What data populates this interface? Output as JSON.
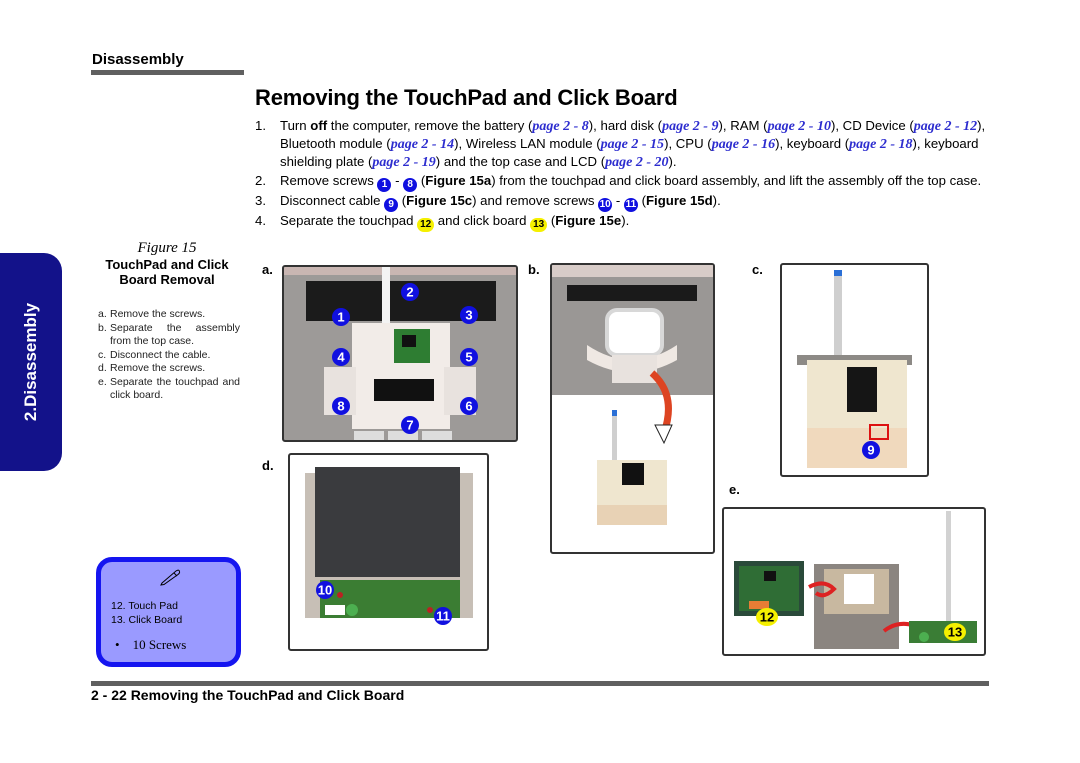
{
  "header": {
    "section_label": "Disassembly",
    "title": "Removing the TouchPad and Click Board"
  },
  "side_tab": {
    "label": "2.Disassembly"
  },
  "steps": [
    {
      "num": "1.",
      "parts": [
        {
          "t": "Turn "
        },
        {
          "b": "off"
        },
        {
          "t": " the computer, remove the battery ("
        },
        {
          "ref": "page 2 - 8"
        },
        {
          "t": "), hard disk ("
        },
        {
          "ref": "page 2 - 9"
        },
        {
          "t": "),  RAM ("
        },
        {
          "ref": "page 2 - 10"
        },
        {
          "t": "), CD Device ("
        },
        {
          "ref": "page 2 - 12"
        },
        {
          "t": "), Bluetooth module ("
        },
        {
          "ref": "page 2 - 14"
        },
        {
          "t": "), Wireless LAN module ("
        },
        {
          "ref": "page 2 - 15"
        },
        {
          "t": "), CPU ("
        },
        {
          "ref": "page 2 - 16"
        },
        {
          "t": "), keyboard ("
        },
        {
          "ref": "page 2 - 18"
        },
        {
          "t": "), keyboard shielding plate ("
        },
        {
          "ref": "page 2 - 19"
        },
        {
          "t": ") and the top case and LCD ("
        },
        {
          "ref": "page 2 - 20"
        },
        {
          "t": ")."
        }
      ]
    },
    {
      "num": "2.",
      "parts": [
        {
          "t": "Remove screws "
        },
        {
          "badge": "1"
        },
        {
          "t": " - "
        },
        {
          "badge": "8"
        },
        {
          "t": " ("
        },
        {
          "b": "Figure 15a"
        },
        {
          "t": ") from the touchpad and click board assembly, and lift the assembly off the top case."
        }
      ]
    },
    {
      "num": "3.",
      "parts": [
        {
          "t": "Disconnect cable "
        },
        {
          "badge": "9"
        },
        {
          "t": " ("
        },
        {
          "b": "Figure 15c"
        },
        {
          "t": ") and remove screws "
        },
        {
          "badge": "10"
        },
        {
          "t": " - "
        },
        {
          "badge": "11"
        },
        {
          "t": " ("
        },
        {
          "b": "Figure 15d"
        },
        {
          "t": ")."
        }
      ]
    },
    {
      "num": "4.",
      "parts": [
        {
          "t": "Separate the touchpad "
        },
        {
          "ybadge": "12"
        },
        {
          "t": " and click board "
        },
        {
          "ybadge": "13"
        },
        {
          "t": "  ("
        },
        {
          "b": "Figure 15e"
        },
        {
          "t": ")."
        }
      ]
    }
  ],
  "figure": {
    "number": "Figure 15",
    "title_line1": "TouchPad and Click",
    "title_line2": "Board Removal",
    "items": [
      {
        "k": "a.",
        "v": "Remove the screws."
      },
      {
        "k": "b.",
        "v": "Separate the assembly from the top case."
      },
      {
        "k": "c.",
        "v": "Disconnect the cable."
      },
      {
        "k": "d.",
        "v": "Remove the screws."
      },
      {
        "k": "e.",
        "v": "Separate the touchpad and click board."
      }
    ],
    "panels": {
      "a": {
        "label": "a.",
        "callouts": [
          "1",
          "2",
          "3",
          "4",
          "5",
          "6",
          "7",
          "8"
        ]
      },
      "b": {
        "label": "b."
      },
      "c": {
        "label": "c.",
        "callouts": [
          "9"
        ]
      },
      "d": {
        "label": "d.",
        "callouts": [
          "10",
          "11"
        ]
      },
      "e": {
        "label": "e.",
        "callouts": [
          "12",
          "13"
        ]
      }
    }
  },
  "note": {
    "icon": "pen-icon",
    "items": [
      "12. Touch Pad",
      "13. Click Board"
    ],
    "bullet": "10 Screws"
  },
  "footer": {
    "text": "2 - 22  Removing the TouchPad and Click Board"
  },
  "colors": {
    "tab": "#13128a",
    "badge_blue": "#1010e0",
    "badge_yellow": "#f5f000",
    "link": "#2d2dcf",
    "note_fill": "#9a9aff",
    "note_border": "#1515f0",
    "rule": "#606060"
  }
}
